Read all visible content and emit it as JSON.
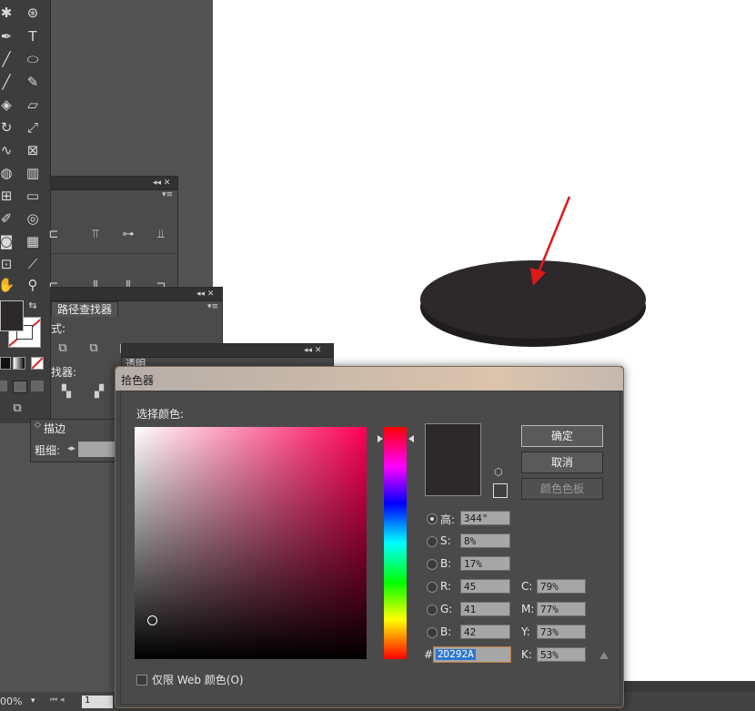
{
  "panels": {
    "align": {
      "controls": "◂◂ ✕",
      "menu": "▾≡"
    },
    "pathfinder": {
      "tab": "路径查找器",
      "shape_modes": "式:",
      "pathfinders": "找器:",
      "controls": "◂◂ ✕",
      "menu": "▾≡"
    },
    "stroke": {
      "tab": "描边",
      "weight_label": "粗细:",
      "collapse": "◇"
    },
    "transparency": {
      "tab": "透明",
      "controls": "◂◂ ✕"
    }
  },
  "statusbar": {
    "zoom": "00%",
    "page": "1"
  },
  "color_picker": {
    "title": "拾色器",
    "select_label": "选择颜色:",
    "ok": "确定",
    "cancel": "取消",
    "swatches": "颜色色板",
    "hsb": [
      {
        "label": "高:",
        "value": "344°",
        "selected": true
      },
      {
        "label": "S:",
        "value": "8%",
        "selected": false
      },
      {
        "label": "B:",
        "value": "17%",
        "selected": false
      }
    ],
    "rgb": [
      {
        "label": "R:",
        "value": "45"
      },
      {
        "label": "G:",
        "value": "41"
      },
      {
        "label": "B:",
        "value": "42"
      }
    ],
    "cmyk": [
      {
        "label": "C:",
        "value": "79%"
      },
      {
        "label": "M:",
        "value": "77%"
      },
      {
        "label": "Y:",
        "value": "73%"
      },
      {
        "label": "K:",
        "value": "53%"
      }
    ],
    "hex_label": "#",
    "hex": "2D292A",
    "web_only": "仅限 Web 颜色(O)",
    "current_color": "#2d292a"
  },
  "canvas": {
    "ellipse_color": "#2d292a",
    "arrow_color": "#e01818"
  }
}
